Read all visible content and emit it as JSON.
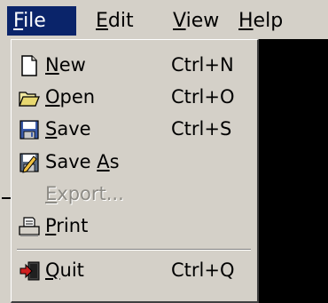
{
  "menubar": {
    "menus": [
      {
        "label_first": "F",
        "label_rest": "ile"
      },
      {
        "label_first": "E",
        "label_rest": "dit"
      },
      {
        "label_first": "V",
        "label_rest": "iew"
      },
      {
        "label_first": "H",
        "label_rest": "elp"
      }
    ],
    "active_menu": "File",
    "highlight_color": "#0a246a"
  },
  "file_menu": {
    "items": [
      {
        "pre": "",
        "mnemonic": "N",
        "post": "ew",
        "accel": "Ctrl+N",
        "icon": "new-document-icon",
        "enabled": true
      },
      {
        "pre": "",
        "mnemonic": "O",
        "post": "pen",
        "accel": "Ctrl+O",
        "icon": "open-folder-icon",
        "enabled": true
      },
      {
        "pre": "",
        "mnemonic": "S",
        "post": "ave",
        "accel": "Ctrl+S",
        "icon": "save-disk-icon",
        "enabled": true
      },
      {
        "pre": "Save ",
        "mnemonic": "A",
        "post": "s",
        "accel": "",
        "icon": "save-as-icon",
        "enabled": true
      },
      {
        "pre": "",
        "mnemonic": "E",
        "post": "xport...",
        "accel": "",
        "icon": "",
        "enabled": false
      },
      {
        "pre": "",
        "mnemonic": "P",
        "post": "rint",
        "accel": "",
        "icon": "printer-icon",
        "enabled": true
      },
      {
        "pre": "",
        "mnemonic": "Q",
        "post": "uit",
        "accel": "Ctrl+Q",
        "icon": "quit-icon",
        "enabled": true
      }
    ]
  }
}
